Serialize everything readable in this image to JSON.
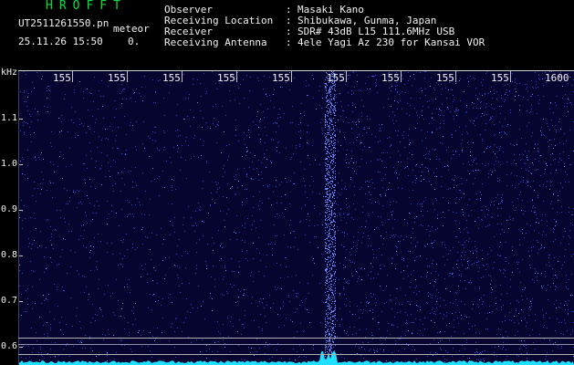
{
  "app": {
    "name": "HROFFT",
    "filename": "UT2511261550.pn",
    "meteor_label": "meteor",
    "datetime": "25.11.26 15:50",
    "count": "0."
  },
  "info": [
    {
      "label": "Observer",
      "sep": ":",
      "value": "Masaki Kano"
    },
    {
      "label": "Receiving Location",
      "sep": ":",
      "value": "Shibukawa, Gunma, Japan"
    },
    {
      "label": "Receiver",
      "sep": ":",
      "value": "SDR# 43dB L15 111.6MHz USB"
    },
    {
      "label": "Receiving Antenna",
      "sep": ":",
      "value": "4ele Yagi Az 230 for Kansai VOR"
    }
  ],
  "spectrogram": {
    "unit_label": "kHz",
    "x_tick_labels": [
      "155",
      "155",
      "155",
      "155",
      "155",
      "155",
      "155",
      "155",
      "155",
      "1600"
    ],
    "y_tick_labels": [
      "1.1",
      "1.0",
      "0.9",
      "0.8",
      "0.7",
      "0.6"
    ],
    "colors": {
      "background": "#050530",
      "noise": "#3040d0",
      "signal": "#6a8cff",
      "trace": "#20e0ff",
      "reference_line": "#c8c8c8"
    }
  }
}
